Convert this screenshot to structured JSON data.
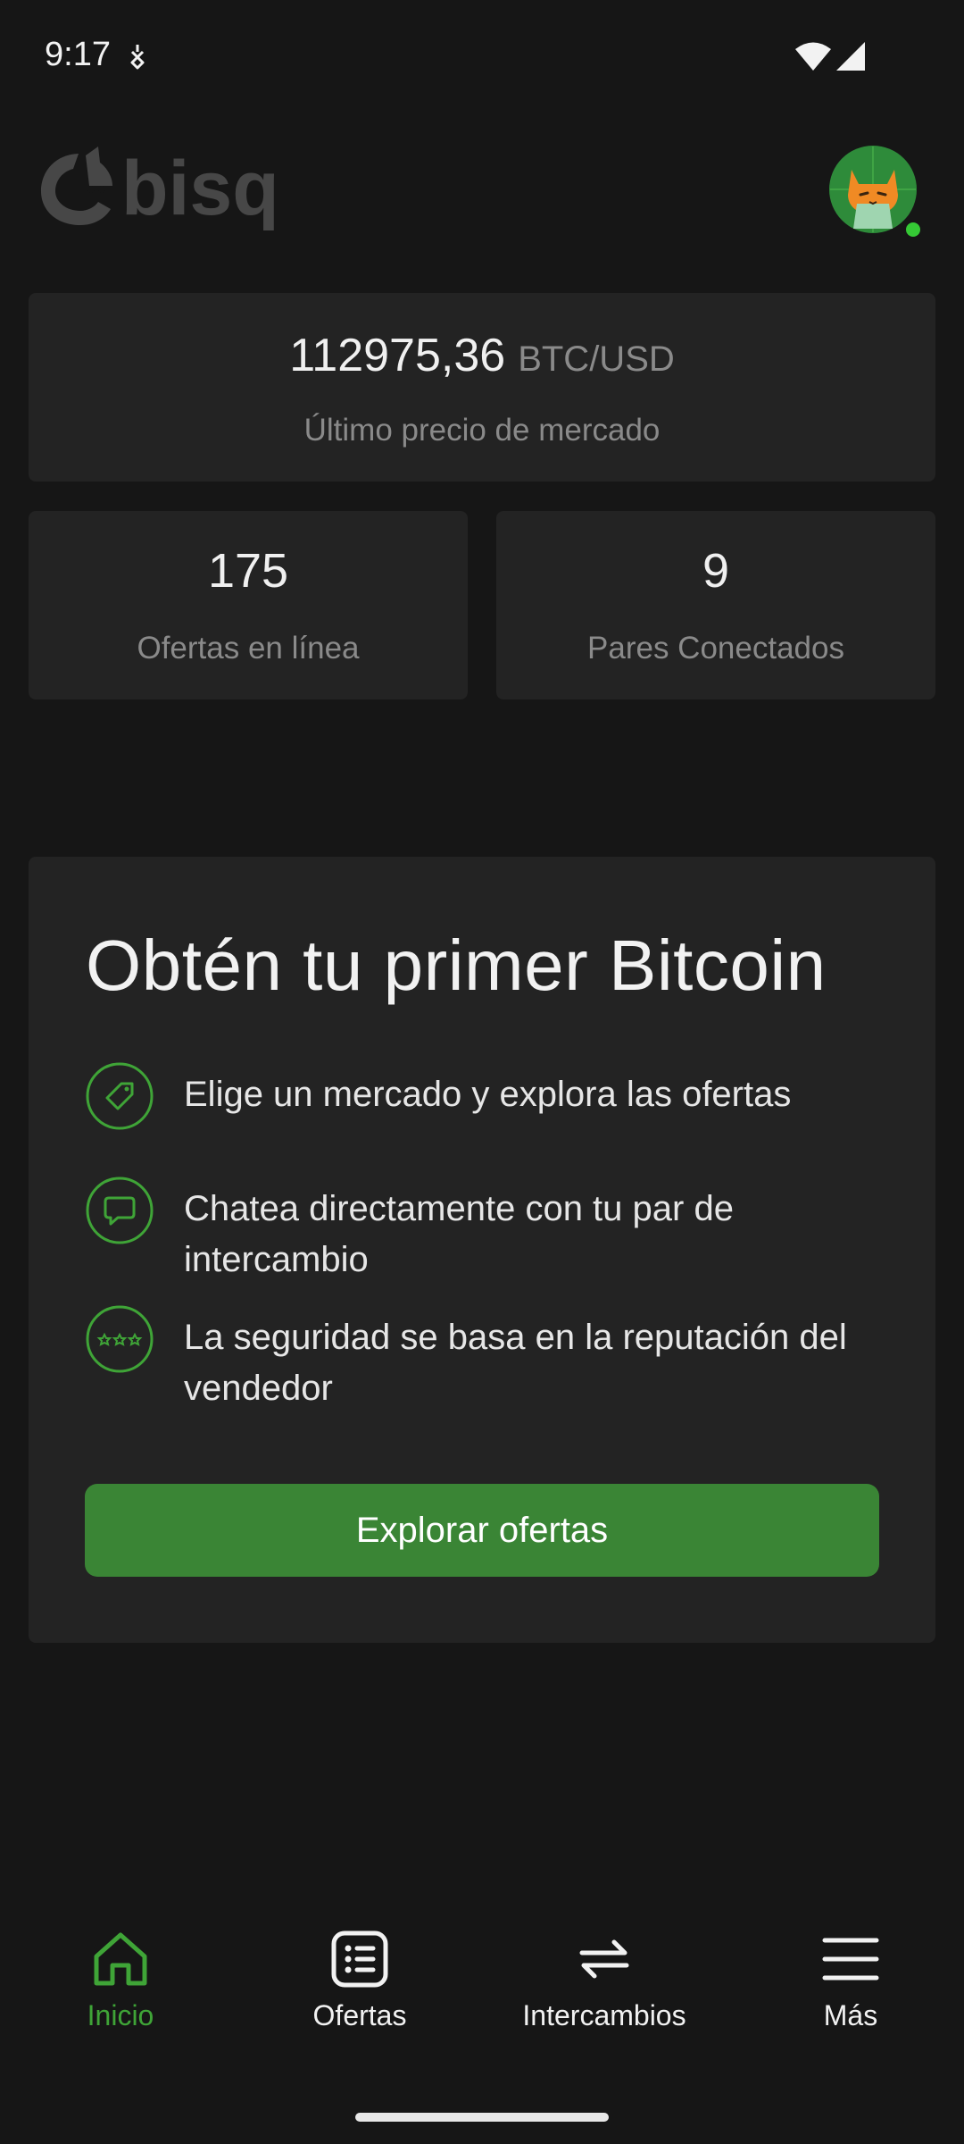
{
  "status_bar": {
    "time": "9:17"
  },
  "header": {
    "logo_text": "bisq"
  },
  "market": {
    "price": "112975,36",
    "pair": "BTC/USD",
    "label": "Último precio de mercado"
  },
  "stats": [
    {
      "value": "175",
      "label": "Ofertas en línea"
    },
    {
      "value": "9",
      "label": "Pares Conectados"
    }
  ],
  "onboarding": {
    "title": "Obtén tu primer Bitcoin",
    "features": [
      {
        "icon": "tag-icon",
        "text": "Elige un mercado y explora las ofertas"
      },
      {
        "icon": "chat-icon",
        "text": "Chatea directamente con tu par de intercambio"
      },
      {
        "icon": "stars-icon",
        "text": "La seguridad se basa en la reputación del vendedor"
      }
    ],
    "cta_label": "Explorar ofertas"
  },
  "nav": {
    "items": [
      {
        "label": "Inicio",
        "icon": "home-icon",
        "active": true
      },
      {
        "label": "Ofertas",
        "icon": "offers-list-icon",
        "active": false
      },
      {
        "label": "Intercambios",
        "icon": "swap-arrows-icon",
        "active": false
      },
      {
        "label": "Más",
        "icon": "menu-icon",
        "active": false
      }
    ]
  },
  "colors": {
    "accent": "#3fa437",
    "button": "#3a8535",
    "background": "#161616",
    "card": "#232323"
  }
}
